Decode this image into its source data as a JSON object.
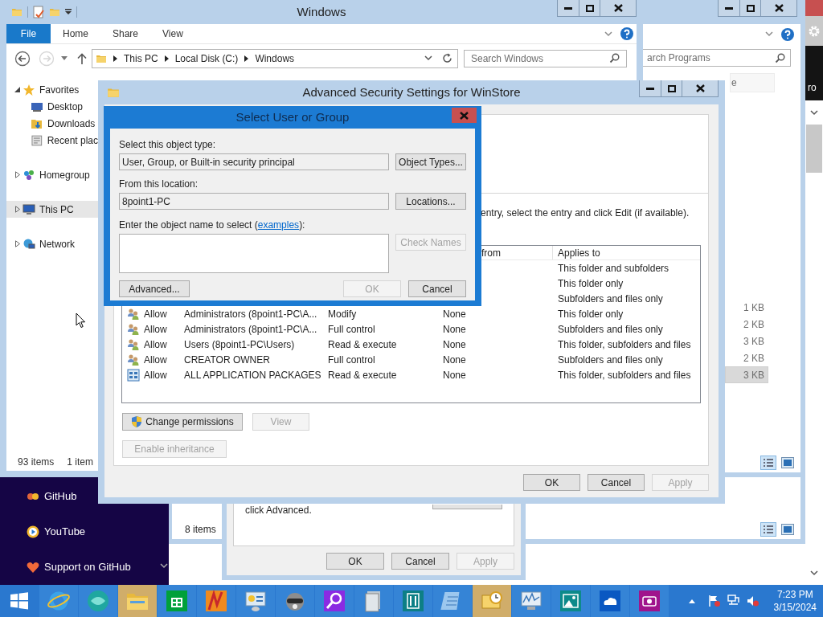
{
  "desktop_panel": {
    "links": [
      {
        "label": "GitHub",
        "kind": "github"
      },
      {
        "label": "YouTube",
        "kind": "youtube"
      },
      {
        "label": "Support on GitHub",
        "kind": "heart"
      }
    ]
  },
  "right_strip": {
    "text": "ro"
  },
  "back_window": {
    "status": "8 items"
  },
  "programs_window": {
    "search": {
      "placeholder": "arch Programs"
    },
    "column_heading": "e",
    "sizes": [
      {
        "text": "1 KB",
        "selected": false
      },
      {
        "text": "2 KB",
        "selected": false
      },
      {
        "text": "3 KB",
        "selected": false
      },
      {
        "text": "2 KB",
        "selected": false
      },
      {
        "text": "3 KB",
        "selected": true
      }
    ]
  },
  "properties_dialog": {
    "note": "click Advanced.",
    "buttons": [
      {
        "label": "OK",
        "disabled": false
      },
      {
        "label": "Cancel",
        "disabled": false
      },
      {
        "label": "Apply",
        "disabled": true
      }
    ]
  },
  "explorer": {
    "title": "Windows",
    "ribbon_tabs": [
      {
        "label": "File",
        "kind": "menu"
      },
      {
        "label": "Home",
        "kind": "tab"
      },
      {
        "label": "Share",
        "kind": "tab"
      },
      {
        "label": "View",
        "kind": "tab"
      }
    ],
    "back_disabled": false,
    "forward_disabled": true,
    "breadcrumb": [
      "This PC",
      "Local Disk (C:)",
      "Windows"
    ],
    "search": {
      "placeholder": "Search Windows"
    },
    "nav": [
      {
        "label": "Favorites",
        "kind": "favorites",
        "expanded": true,
        "selected": false,
        "children": [
          {
            "label": "Desktop",
            "kind": "desktop",
            "selected": false
          },
          {
            "label": "Downloads",
            "kind": "downloads",
            "selected": false
          },
          {
            "label": "Recent plac",
            "kind": "recent",
            "selected": false
          }
        ]
      },
      {
        "label": "Homegroup",
        "kind": "homegroup",
        "expanded": false,
        "selected": false
      },
      {
        "label": "This PC",
        "kind": "pc",
        "expanded": false,
        "selected": true
      },
      {
        "label": "Network",
        "kind": "network",
        "expanded": false,
        "selected": false
      }
    ],
    "status": [
      "93 items",
      "1 item"
    ]
  },
  "advanced_security": {
    "title": "Advanced Security Settings for WinStore",
    "instruction": "entry, select the entry and click Edit (if available).",
    "header": {
      "inherited_from": "from",
      "applies_to": "Applies to"
    },
    "rows": [
      {
        "applies_to": "This folder and subfolders"
      },
      {
        "applies_to": "This folder only"
      },
      {
        "applies_to": "Subfolders and files only"
      },
      {
        "kind": "group",
        "type": "Allow",
        "principal": "Administrators (8point1-PC\\A...",
        "access": "Modify",
        "inherited_from": "None",
        "applies_to": "This folder only"
      },
      {
        "kind": "group",
        "type": "Allow",
        "principal": "Administrators (8point1-PC\\A...",
        "access": "Full control",
        "inherited_from": "None",
        "applies_to": "Subfolders and files only"
      },
      {
        "kind": "group",
        "type": "Allow",
        "principal": "Users (8point1-PC\\Users)",
        "access": "Read & execute",
        "inherited_from": "None",
        "applies_to": "This folder, subfolders and files"
      },
      {
        "kind": "group",
        "type": "Allow",
        "principal": "CREATOR OWNER",
        "access": "Full control",
        "inherited_from": "None",
        "applies_to": "Subfolders and files only"
      },
      {
        "kind": "package",
        "type": "Allow",
        "principal": "ALL APPLICATION PACKAGES",
        "access": "Read & execute",
        "inherited_from": "None",
        "applies_to": "This folder, subfolders and files"
      }
    ],
    "change_permissions": {
      "label": "Change permissions",
      "disabled": false
    },
    "view": {
      "label": "View",
      "disabled": true
    },
    "enable_inheritance": {
      "label": "Enable inheritance",
      "disabled": true
    },
    "buttons": [
      {
        "label": "OK",
        "disabled": false
      },
      {
        "label": "Cancel",
        "disabled": false
      },
      {
        "label": "Apply",
        "disabled": true
      }
    ]
  },
  "select_dialog": {
    "title": "Select User or Group",
    "object_type_label": "Select this object type:",
    "object_type": "User, Group, or Built-in security principal",
    "object_types_button": {
      "label": "Object Types...",
      "disabled": false
    },
    "location_label": "From this location:",
    "location": "8point1-PC",
    "locations_button": {
      "label": "Locations...",
      "disabled": false
    },
    "name_label": "Enter the object name to select (",
    "examples_link": "examples",
    "name_label_end": "):",
    "check_names": {
      "label": "Check Names",
      "disabled": true
    },
    "advanced": {
      "label": "Advanced...",
      "disabled": false
    },
    "ok": {
      "label": "OK",
      "disabled": true
    },
    "cancel": {
      "label": "Cancel",
      "disabled": false
    }
  },
  "taskbar": {
    "apps": [
      {
        "kind": "ie",
        "active": false
      },
      {
        "kind": "sphere",
        "active": false
      },
      {
        "kind": "folder",
        "active": true
      },
      {
        "kind": "store",
        "active": false
      },
      {
        "kind": "paint",
        "active": false
      },
      {
        "kind": "control",
        "active": false
      },
      {
        "kind": "raccoon",
        "active": false
      },
      {
        "kind": "search",
        "active": false
      },
      {
        "kind": "files",
        "active": false
      },
      {
        "kind": "dining",
        "active": false
      },
      {
        "kind": "notepad",
        "active": false
      },
      {
        "kind": "clock",
        "active": true
      },
      {
        "kind": "monitor",
        "active": false
      },
      {
        "kind": "photos",
        "active": false
      },
      {
        "kind": "cloud",
        "active": false
      },
      {
        "kind": "camera",
        "active": false
      }
    ],
    "time": "7:23 PM",
    "date": "3/15/2024"
  }
}
